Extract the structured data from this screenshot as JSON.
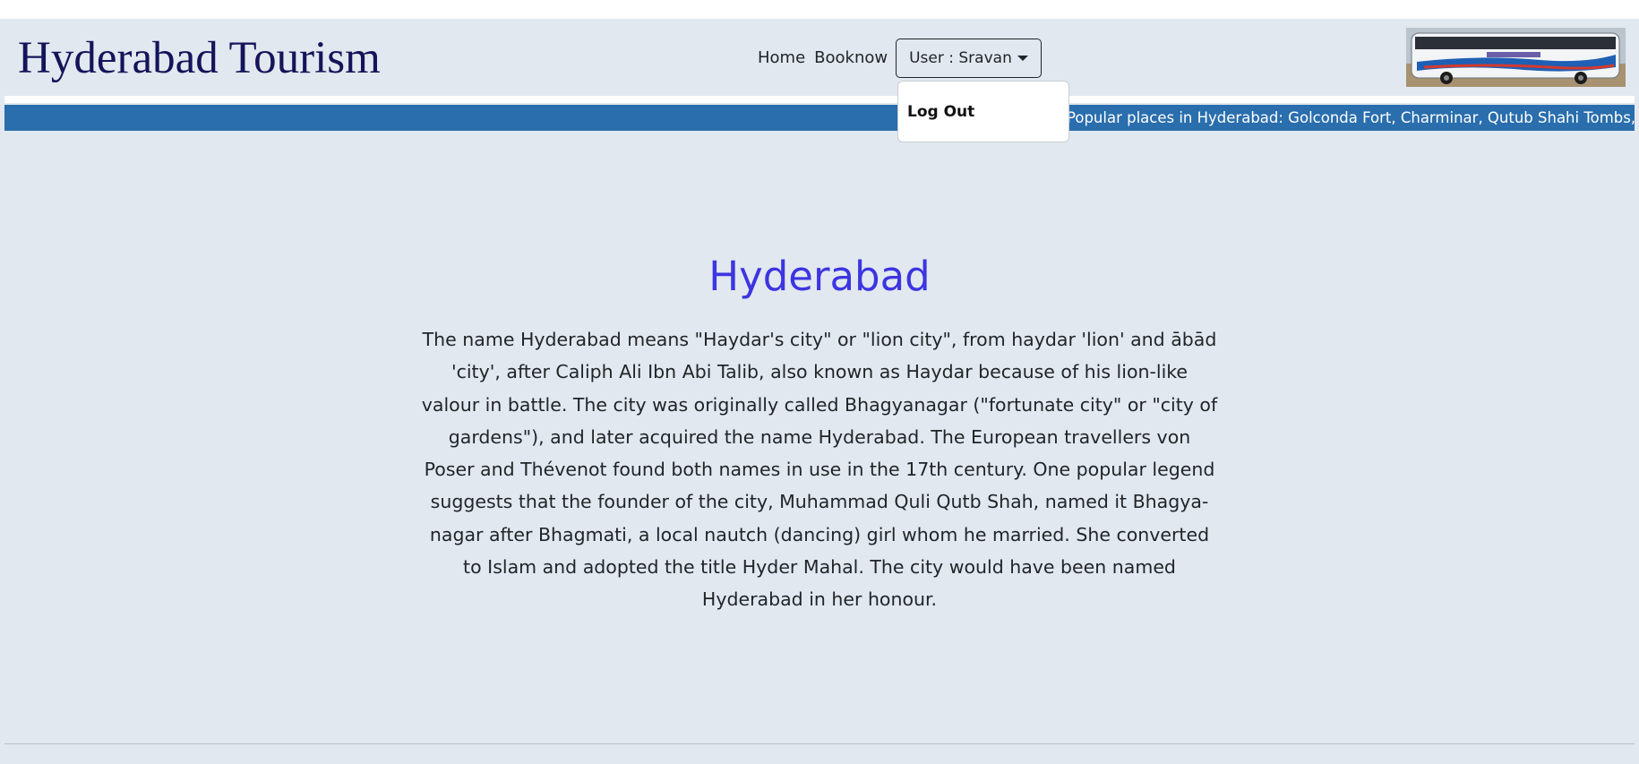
{
  "navbar": {
    "brand": "Hyderabad Tourism",
    "links": [
      {
        "label": "Home"
      },
      {
        "label": "Booknow"
      }
    ],
    "user_menu": {
      "label": "User : Sravan",
      "items": [
        {
          "label": "Log Out"
        }
      ]
    },
    "bus_image": "bus-photo"
  },
  "marquee": {
    "text": "Popular places in Hyderabad: Golconda Fort, Charminar, Qutub Shahi Tombs, Mecca Masjid, Chowmahalla Palace, Hussain Sagar Lake"
  },
  "main": {
    "title": "Hyderabad",
    "paragraph": "The name Hyderabad means \"Haydar's city\" or \"lion city\", from haydar 'lion' and ābād 'city', after Caliph Ali Ibn Abi Talib, also known as Haydar because of his lion-like valour in battle. The city was originally called Bhagyanagar (\"fortunate city\" or \"city of gardens\"), and later acquired the name Hyderabad. The European travellers von Poser and Thévenot found both names in use in the 17th century. One popular legend suggests that the founder of the city, Muhammad Quli Qutb Shah, named it Bhagya-nagar after Bhagmati, a local nautch (dancing) girl whom he married. She converted to Islam and adopted the title Hyder Mahal. The city would have been named Hyderabad in her honour."
  },
  "colors": {
    "page_background": "#e2e8ef",
    "brand_text": "#14145a",
    "marquee_background": "#2a6ead",
    "title_accent": "#3c35e0"
  }
}
